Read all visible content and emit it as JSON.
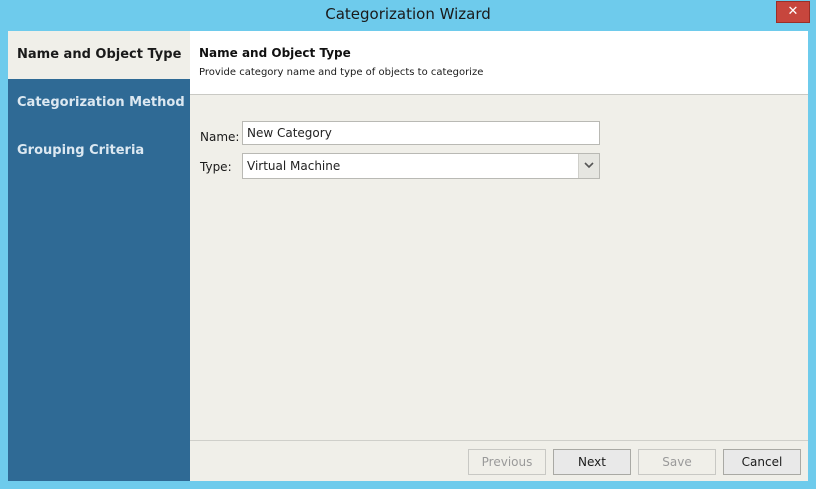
{
  "window": {
    "title": "Categorization Wizard",
    "close_label": "✕"
  },
  "sidebar": {
    "items": [
      {
        "label": "Name and Object Type",
        "active": true
      },
      {
        "label": "Categorization Method",
        "active": false
      },
      {
        "label": "Grouping Criteria",
        "active": false
      }
    ]
  },
  "header": {
    "title": "Name and Object Type",
    "subtitle": "Provide category name and type of objects to categorize"
  },
  "form": {
    "name_label": "Name:",
    "name_value": "New Category",
    "type_label": "Type:",
    "type_value": "Virtual Machine",
    "type_arrow_icon": "chevron-down-icon"
  },
  "buttons": {
    "previous": "Previous",
    "next": "Next",
    "save": "Save",
    "cancel": "Cancel"
  },
  "colors": {
    "titlebar": "#6ecbec",
    "sidebar": "#2f6a95",
    "content_bg": "#f0efe9",
    "close": "#c7463d"
  }
}
